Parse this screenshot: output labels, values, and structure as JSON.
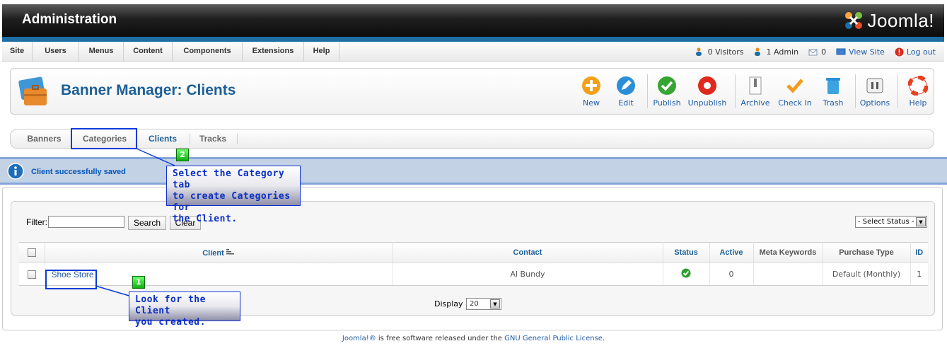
{
  "header": {
    "title": "Administration",
    "logo_text": "Joomla!"
  },
  "menu": {
    "items": [
      "Site",
      "Users",
      "Menus",
      "Content",
      "Components",
      "Extensions",
      "Help"
    ]
  },
  "status": {
    "visitors": "0 Visitors",
    "admins": "1 Admin",
    "messages": "0",
    "view_site": "View Site",
    "logout": "Log out"
  },
  "toolbar": {
    "title": "Banner Manager: Clients",
    "buttons": {
      "new": "New",
      "edit": "Edit",
      "publish": "Publish",
      "unpublish": "Unpublish",
      "archive": "Archive",
      "checkin": "Check In",
      "trash": "Trash",
      "options": "Options",
      "help": "Help"
    }
  },
  "submenu": {
    "banners": "Banners",
    "categories": "Categories",
    "clients": "Clients",
    "tracks": "Tracks"
  },
  "message": "Client successfully saved",
  "filter": {
    "label": "Filter:",
    "value": "",
    "search_label": "Search",
    "clear_label": "Clear",
    "status_select": "- Select Status -"
  },
  "table": {
    "headers": {
      "client": "Client",
      "contact": "Contact",
      "status": "Status",
      "active": "Active",
      "meta": "Meta Keywords",
      "purchase": "Purchase Type",
      "id": "ID"
    },
    "rows": [
      {
        "client": "Shoe Store",
        "contact": "Al Bundy",
        "status": "published",
        "active": "0",
        "meta": "",
        "purchase": "Default (Monthly)",
        "id": "1"
      }
    ]
  },
  "pagination": {
    "label": "Display #",
    "value": "20"
  },
  "footer": {
    "brand": "Joomla!®",
    "middle": " is free software released under the ",
    "license": "GNU General Public License",
    "end": "."
  },
  "annotations": {
    "step1": {
      "number": "1",
      "text_line1": "Look for the Client",
      "text_line2": "you created."
    },
    "step2": {
      "number": "2",
      "text_line1": "Select the Category tab",
      "text_line2": "to create Categories for",
      "text_line3": "the Client."
    }
  },
  "colors": {
    "accent": "#1c5f96",
    "link": "#1f5ca8",
    "message_bg": "#c3d2e5",
    "annotation": "#0b3bd8"
  }
}
